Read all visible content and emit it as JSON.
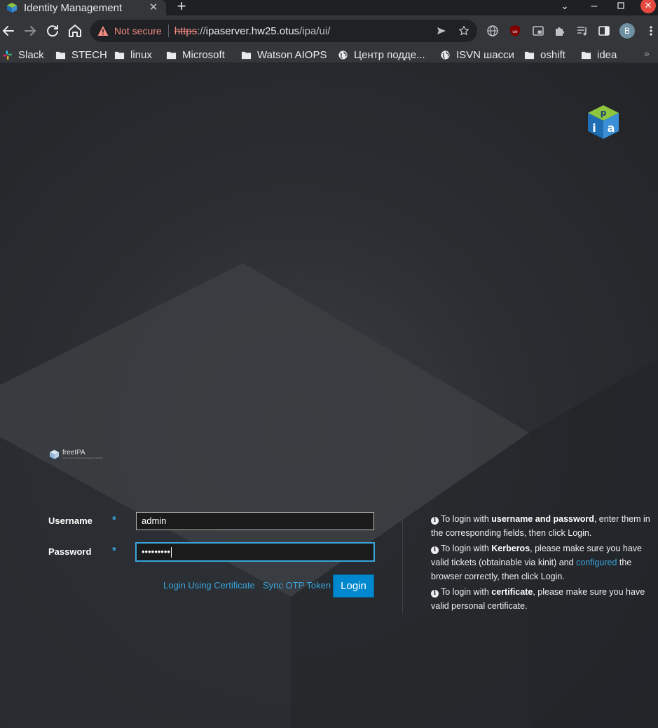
{
  "browser": {
    "tab": {
      "title": "Identity Management"
    },
    "omnibox": {
      "security_label": "Not secure",
      "url_scheme": "https",
      "url_sep": "://",
      "url_host": "ipaserver.hw25.otus",
      "url_path": "/ipa/ui/"
    },
    "profile_initial": "B",
    "bookmarks": [
      {
        "label": "Slack",
        "icon": "slack-icon"
      },
      {
        "label": "STECH",
        "icon": "folder-icon"
      },
      {
        "label": "linux",
        "icon": "folder-icon"
      },
      {
        "label": "Microsoft",
        "icon": "folder-icon"
      },
      {
        "label": "Watson AIOPS",
        "icon": "folder-icon"
      },
      {
        "label": "Центр подде...",
        "icon": "globe-icon"
      },
      {
        "label": "ISVN шасси",
        "icon": "globe-icon"
      },
      {
        "label": "oshift",
        "icon": "folder-icon"
      },
      {
        "label": "idea",
        "icon": "folder-icon"
      }
    ]
  },
  "brand": {
    "name": "freeIPA",
    "tagline": "Open Source Identity Management Solution"
  },
  "login": {
    "username_label": "Username",
    "password_label": "Password",
    "required_marker": "*",
    "username_value": "admin",
    "password_masked": "•••••••••",
    "login_cert_link": "Login Using Certificate",
    "sync_otp_link": "Sync OTP Token",
    "login_button": "Login"
  },
  "help": {
    "p1_pre": "To login with ",
    "p1_bold": "username and password",
    "p1_post": ", enter them in the corresponding fields, then click Login.",
    "p2_pre": "To login with ",
    "p2_bold": "Kerberos",
    "p2_mid": ", please make sure you have valid tickets (obtainable via kinit) and ",
    "p2_link": "configured",
    "p2_post": " the browser correctly, then click Login.",
    "p3_pre": "To login with ",
    "p3_bold": "certificate",
    "p3_post": ", please make sure you have valid personal certificate."
  },
  "colors": {
    "accent": "#39a5dc",
    "button": "#0088ce",
    "warning": "#f28b82",
    "window_close": "#e5493f"
  }
}
